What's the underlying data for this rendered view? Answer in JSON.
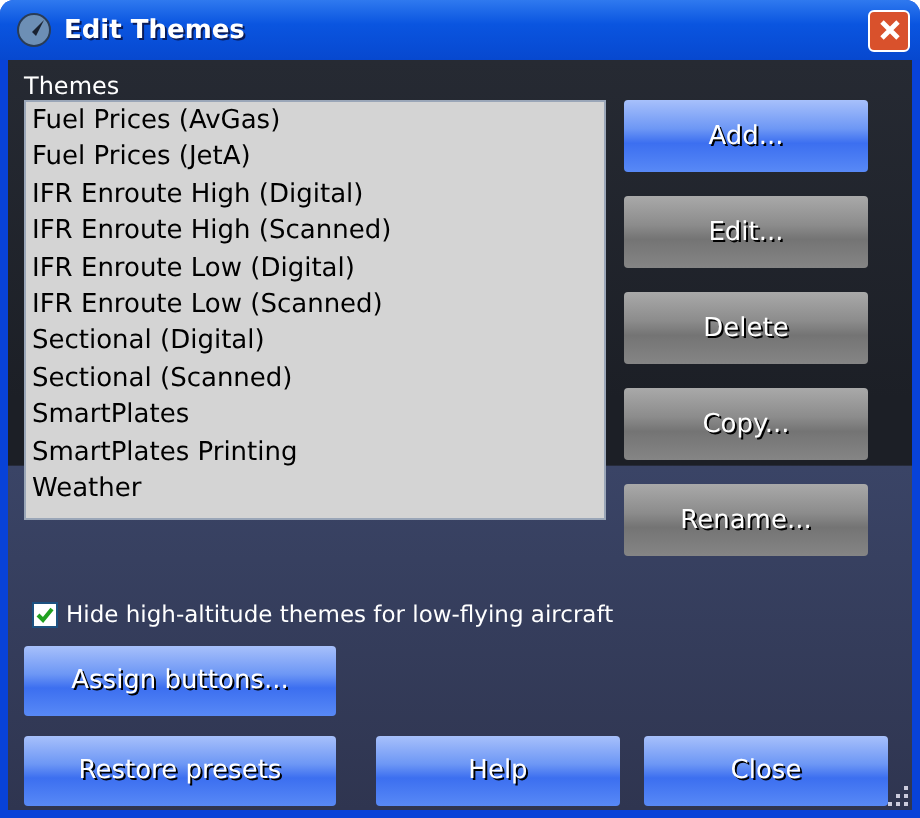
{
  "window": {
    "title": "Edit Themes"
  },
  "themes": {
    "label": "Themes",
    "items": [
      {
        "label": "Fuel Prices (AvGas)",
        "selected": false
      },
      {
        "label": "Fuel Prices (JetA)",
        "selected": false
      },
      {
        "label": "IFR Enroute High (Digital)",
        "selected": false
      },
      {
        "label": "IFR Enroute High (Scanned)",
        "selected": false
      },
      {
        "label": "IFR Enroute Low (Digital)",
        "selected": false
      },
      {
        "label": "IFR Enroute Low (Scanned)",
        "selected": false
      },
      {
        "label": "Sectional (Digital)",
        "selected": false
      },
      {
        "label": "Sectional (Scanned)",
        "selected": false
      },
      {
        "label": "SmartPlates",
        "selected": false
      },
      {
        "label": "SmartPlates Printing",
        "selected": false
      },
      {
        "label": "Weather",
        "selected": false
      }
    ]
  },
  "side_buttons": [
    {
      "label": "Add...",
      "disabled": false
    },
    {
      "label": "Edit...",
      "disabled": true
    },
    {
      "label": "Delete",
      "disabled": true
    },
    {
      "label": "Copy...",
      "disabled": true
    },
    {
      "label": "Rename...",
      "disabled": true
    }
  ],
  "hide_high_altitude": {
    "label": "Hide high-altitude themes for low-flying aircraft",
    "checked": true
  },
  "assign_button": {
    "label": "Assign buttons..."
  },
  "bottom_buttons": [
    {
      "label": "Restore presets"
    },
    {
      "label": "Help"
    },
    {
      "label": "Close"
    }
  ]
}
